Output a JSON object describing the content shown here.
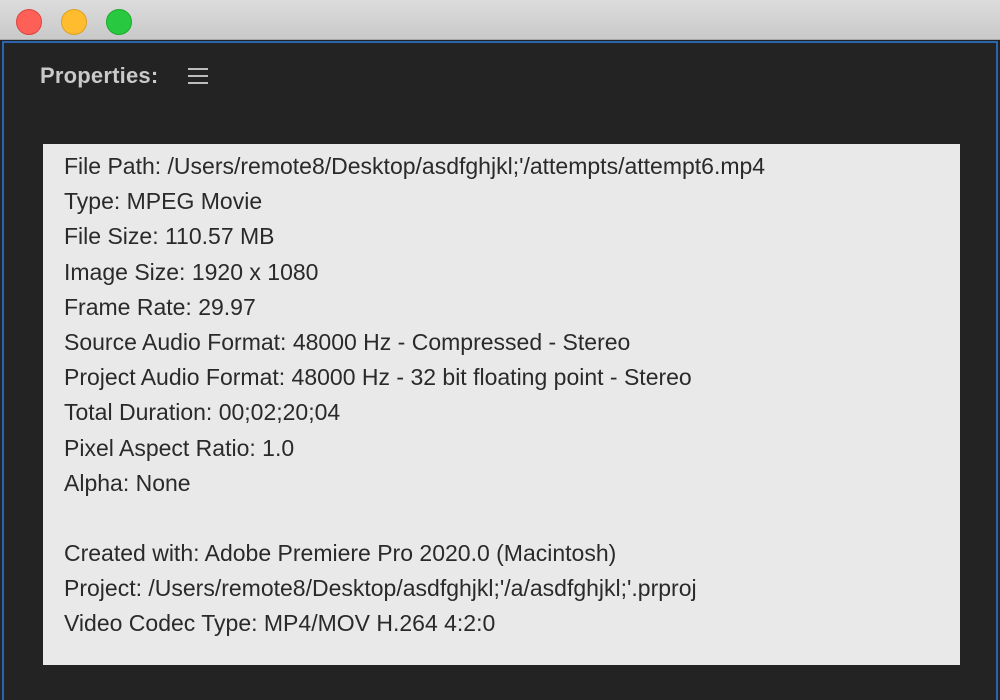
{
  "panel": {
    "title": "Properties:"
  },
  "properties": {
    "group1": [
      "File Path: /Users/remote8/Desktop/asdfghjkl;'/attempts/attempt6.mp4",
      "Type: MPEG Movie",
      "File Size: 110.57 MB",
      "Image Size: 1920 x 1080",
      "Frame Rate: 29.97",
      "Source Audio Format: 48000 Hz - Compressed - Stereo",
      "Project Audio Format: 48000 Hz - 32 bit floating point - Stereo",
      "Total Duration: 00;02;20;04",
      "Pixel Aspect Ratio: 1.0",
      "Alpha: None"
    ],
    "group2": [
      "Created with: Adobe Premiere Pro 2020.0 (Macintosh)",
      "Project: /Users/remote8/Desktop/asdfghjkl;'/a/asdfghjkl;'.prproj",
      "Video Codec Type: MP4/MOV H.264 4:2:0"
    ]
  }
}
